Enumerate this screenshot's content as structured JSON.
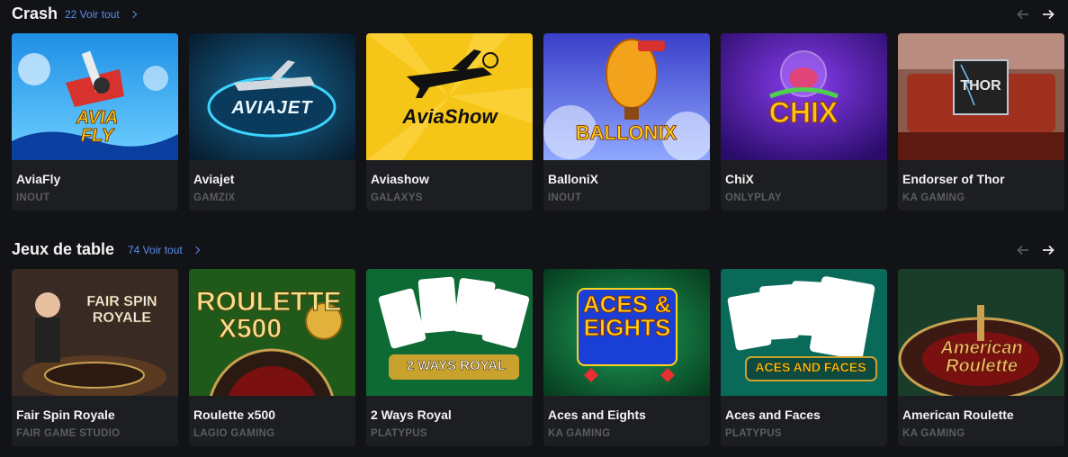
{
  "sections": [
    {
      "title": "Crash",
      "see_all": "22 Voir tout",
      "games": [
        {
          "name": "AviaFly",
          "provider": "INOUT",
          "logo": "AVIA FLY"
        },
        {
          "name": "Aviajet",
          "provider": "GAMZIX",
          "logo": "AVIAJET"
        },
        {
          "name": "Aviashow",
          "provider": "GALAXYS",
          "logo": "AviaShow"
        },
        {
          "name": "BalloniX",
          "provider": "INOUT",
          "logo": "BALLONIX"
        },
        {
          "name": "ChiX",
          "provider": "ONLYPLAY",
          "logo": "CHIX"
        },
        {
          "name": "Endorser of Thor",
          "provider": "KA GAMING",
          "logo": "THOR"
        }
      ]
    },
    {
      "title": "Jeux de table",
      "see_all": "74 Voir tout",
      "games": [
        {
          "name": "Fair Spin Royale",
          "provider": "FAIR GAME STUDIO",
          "logo": "FAIR SPIN ROYALE"
        },
        {
          "name": "Roulette x500",
          "provider": "LAGIO GAMING",
          "logo": "ROULETTE X500"
        },
        {
          "name": "2 Ways Royal",
          "provider": "PLATYPUS",
          "logo": "2 WAYS ROYAL"
        },
        {
          "name": "Aces and Eights",
          "provider": "KA GAMING",
          "logo": "ACES & EIGHTS"
        },
        {
          "name": "Aces and Faces",
          "provider": "PLATYPUS",
          "logo": "ACES AND FACES"
        },
        {
          "name": "American Roulette",
          "provider": "KA GAMING",
          "logo": "American Roulette"
        }
      ]
    }
  ],
  "icons": {
    "prev": "arrow-left-icon",
    "next": "arrow-right-icon",
    "see_all": "chevron-right-icon"
  },
  "colors": {
    "background": "#121316",
    "card": "#1d1e22",
    "link": "#5b8cf0",
    "provider_text": "#5b5d63"
  }
}
